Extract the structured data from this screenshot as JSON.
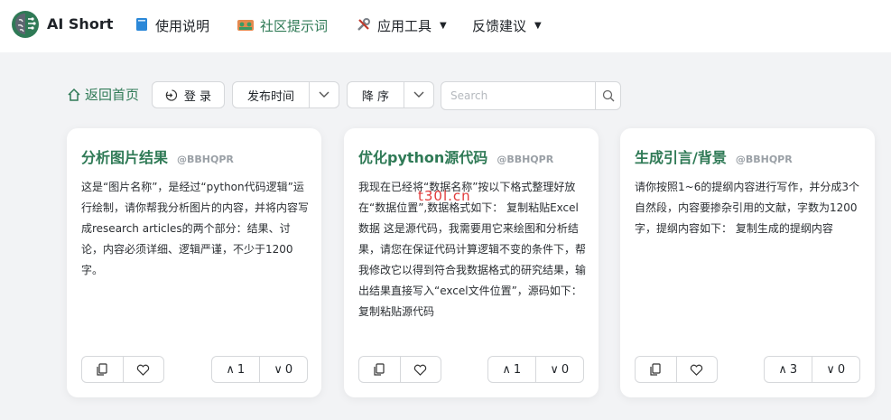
{
  "header": {
    "brand": "AI Short",
    "nav": [
      {
        "label": "使用说明",
        "icon": "book-icon"
      },
      {
        "label": "社区提示词",
        "icon": "community-icon"
      },
      {
        "label": "应用工具",
        "icon": "tools-icon"
      },
      {
        "label": "反馈建议",
        "icon": ""
      }
    ]
  },
  "toolbar": {
    "back": "返回首页",
    "login": "登 录",
    "sort_by": "发布时间",
    "order": "降 序",
    "search_placeholder": "Search"
  },
  "cards": [
    {
      "title": "分析图片结果",
      "author": "@BBHQPR",
      "body": "这是“图片名称”，是经过“python代码逻辑”运行绘制，请你帮我分析图片的内容，并将内容写成research articles的两个部分：结果、讨论，内容必须详细、逻辑严谨，不少于1200字。",
      "up": "1",
      "down": "0"
    },
    {
      "title": "优化python源代码",
      "author": "@BBHQPR",
      "body": "我现在已经将“数据名称”按以下格式整理好放在“数据位置”,数据格式如下： 复制粘贴Excel数据 这是源代码，我需要用它来绘图和分析结果，请您在保证代码计算逻辑不变的条件下，帮我修改它以得到符合我数据格式的研究结果，输出结果直接写入“excel文件位置”，源码如下： 复制粘贴源代码",
      "up": "1",
      "down": "0"
    },
    {
      "title": "生成引言/背景",
      "author": "@BBHQPR",
      "body": "请你按照1~6的提纲内容进行写作，并分成3个自然段，内容要掺杂引用的文献，字数为1200字，提纲内容如下： 复制生成的提纲内容",
      "up": "3",
      "down": "0"
    }
  ],
  "watermark": "t30l.cn",
  "colors": {
    "accent": "#2f7a56",
    "watermark": "#e03a3a"
  }
}
